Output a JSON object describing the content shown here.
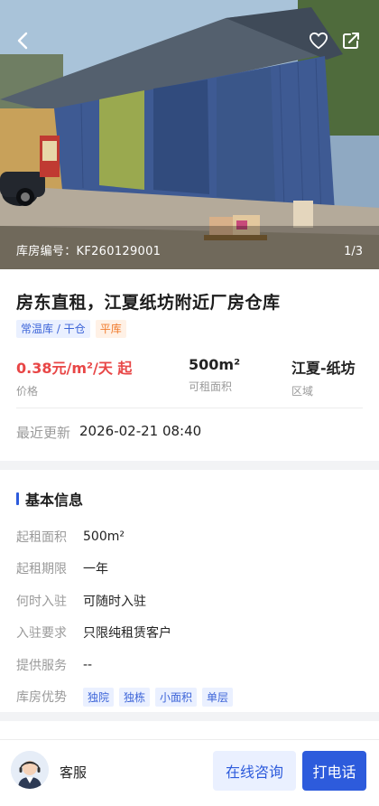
{
  "hero": {
    "code": "库房编号：KF260129001",
    "pager": "1/3",
    "back_icon": "chevron-left-icon",
    "favorite_icon": "heart-icon",
    "share_icon": "share-icon"
  },
  "listing": {
    "title": "房东直租，江夏纸坊附近厂房仓库",
    "tags": [
      {
        "label": "常温库 / 干仓",
        "color": "#3c64d8"
      },
      {
        "label": "平库",
        "color": "#f07b2c"
      }
    ],
    "stats": [
      {
        "value": "0.38元/m²/天 起",
        "label": "价格"
      },
      {
        "value": "500m²",
        "label": "可租面积"
      },
      {
        "value": "江夏-纸坊",
        "label": "区域"
      }
    ],
    "updated_label": "最近更新",
    "updated_value": "2026-02-21 08:40"
  },
  "basic_info": {
    "title": "基本信息",
    "rows": [
      {
        "key": "起租面积",
        "value": "500m²"
      },
      {
        "key": "起租期限",
        "value": "一年"
      },
      {
        "key": "何时入驻",
        "value": "可随时入驻"
      },
      {
        "key": "入驻要求",
        "value": "只限纯租赁客户"
      },
      {
        "key": "提供服务",
        "value": "--"
      },
      {
        "key": "库房优势",
        "chips": [
          "独院",
          "独栋",
          "小面积",
          "单层"
        ]
      }
    ]
  },
  "bottom_bar": {
    "service_label": "客服",
    "consult_label": "在线咨询",
    "call_label": "打电话"
  },
  "colors": {
    "accent": "#2d5bdc",
    "price": "#e84646",
    "tag_orange": "#f07b2c"
  }
}
